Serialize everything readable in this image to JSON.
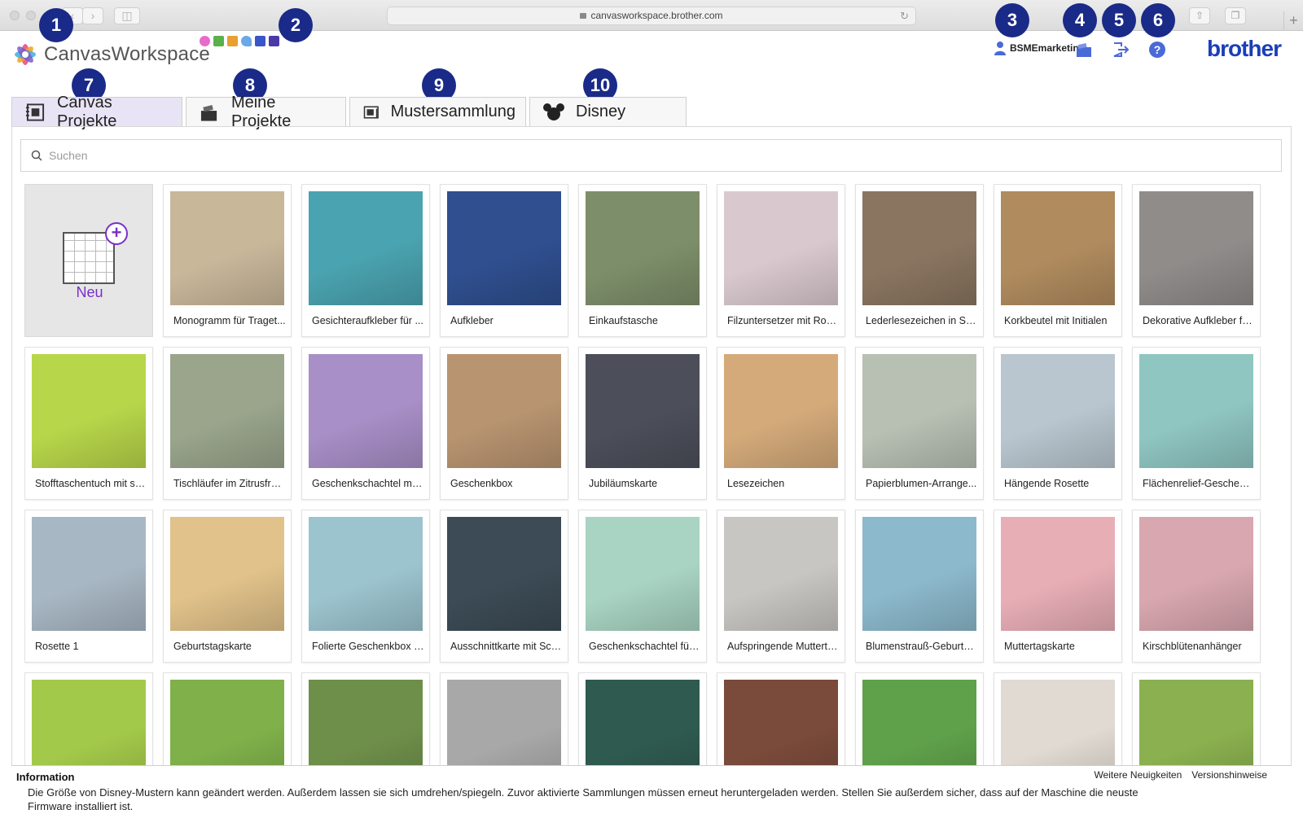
{
  "browser": {
    "url": "canvasworkspace.brother.com"
  },
  "header": {
    "app_name": "CanvasWorkspace",
    "username": "BSMEmarketing",
    "brand": "brother"
  },
  "callouts": [
    "1",
    "2",
    "3",
    "4",
    "5",
    "6",
    "7",
    "8",
    "9",
    "10"
  ],
  "tabs": [
    {
      "label": "Canvas Projekte",
      "icon": "canvas-projects-icon"
    },
    {
      "label": "Meine Projekte",
      "icon": "my-projects-icon"
    },
    {
      "label": "Mustersammlung",
      "icon": "pattern-collection-icon"
    },
    {
      "label": "Disney",
      "icon": "mickey-icon"
    }
  ],
  "search": {
    "placeholder": "Suchen"
  },
  "new_card": {
    "label": "Neu"
  },
  "projects": [
    {
      "label": "Monogramm für Traget...",
      "color": "#c9b79a"
    },
    {
      "label": "Gesichteraufkleber für ...",
      "color": "#4aa3b0"
    },
    {
      "label": "Aufkleber",
      "color": "#2f4f8f"
    },
    {
      "label": "Einkaufstasche",
      "color": "#7d8f6a"
    },
    {
      "label": "Filzuntersetzer mit Rosen",
      "color": "#d9c9cf"
    },
    {
      "label": "Lederlesezeichen in Sc...",
      "color": "#8a7560"
    },
    {
      "label": "Korkbeutel mit Initialen",
      "color": "#b08b5e"
    },
    {
      "label": "Dekorative Aufkleber fü...",
      "color": "#8f8c8a"
    },
    {
      "label": "Stofftaschentuch mit sc...",
      "color": "#b8d64a"
    },
    {
      "label": "Tischläufer im Zitrusfrüc...",
      "color": "#9aa58c"
    },
    {
      "label": "Geschenkschachtel mit ...",
      "color": "#a88fc7"
    },
    {
      "label": "Geschenkbox",
      "color": "#b89470"
    },
    {
      "label": "Jubiläumskarte",
      "color": "#4c4f5a"
    },
    {
      "label": "Lesezeichen",
      "color": "#d4aa7a"
    },
    {
      "label": "Papierblumen-Arrange...",
      "color": "#b7c0b3"
    },
    {
      "label": "Hängende Rosette",
      "color": "#b9c6cf"
    },
    {
      "label": "Flächenrelief-Geschenk...",
      "color": "#8fc6c2"
    },
    {
      "label": "Rosette 1",
      "color": "#a8b7c4"
    },
    {
      "label": "Geburtstagskarte",
      "color": "#e1c28a"
    },
    {
      "label": "Folierte Geschenkbox i...",
      "color": "#9cc4cf"
    },
    {
      "label": "Ausschnittkarte mit Sch...",
      "color": "#3c4b55"
    },
    {
      "label": "Geschenkschachtel für ...",
      "color": "#a9d4c3"
    },
    {
      "label": "Aufspringende Mutterta...",
      "color": "#c8c6c2"
    },
    {
      "label": "Blumenstrauß-Geburtst...",
      "color": "#8cb9cc"
    },
    {
      "label": "Muttertagskarte",
      "color": "#e8aeb6"
    },
    {
      "label": "Kirschblütenanhänger",
      "color": "#d9a7b0"
    },
    {
      "label": "",
      "color": "#a3c94a"
    },
    {
      "label": "",
      "color": "#7fb04a"
    },
    {
      "label": "",
      "color": "#6e8f4a"
    },
    {
      "label": "",
      "color": "#a8a8a8"
    },
    {
      "label": "",
      "color": "#2f5a4f"
    },
    {
      "label": "",
      "color": "#7a4a3a"
    },
    {
      "label": "",
      "color": "#5fa04a"
    },
    {
      "label": "",
      "color": "#e0dad2"
    },
    {
      "label": "",
      "color": "#8ab04f"
    }
  ],
  "info": {
    "title": "Information",
    "text": "Die Größe von Disney-Mustern kann geändert werden. Außerdem lassen sie sich umdrehen/spiegeln. Zuvor aktivierte Sammlungen müssen erneut heruntergeladen werden. Stellen Sie außerdem sicher, dass auf der Maschine die neuste Firmware installiert ist.",
    "link_news": "Weitere Neuigkeiten",
    "link_release": "Versionshinweise"
  }
}
